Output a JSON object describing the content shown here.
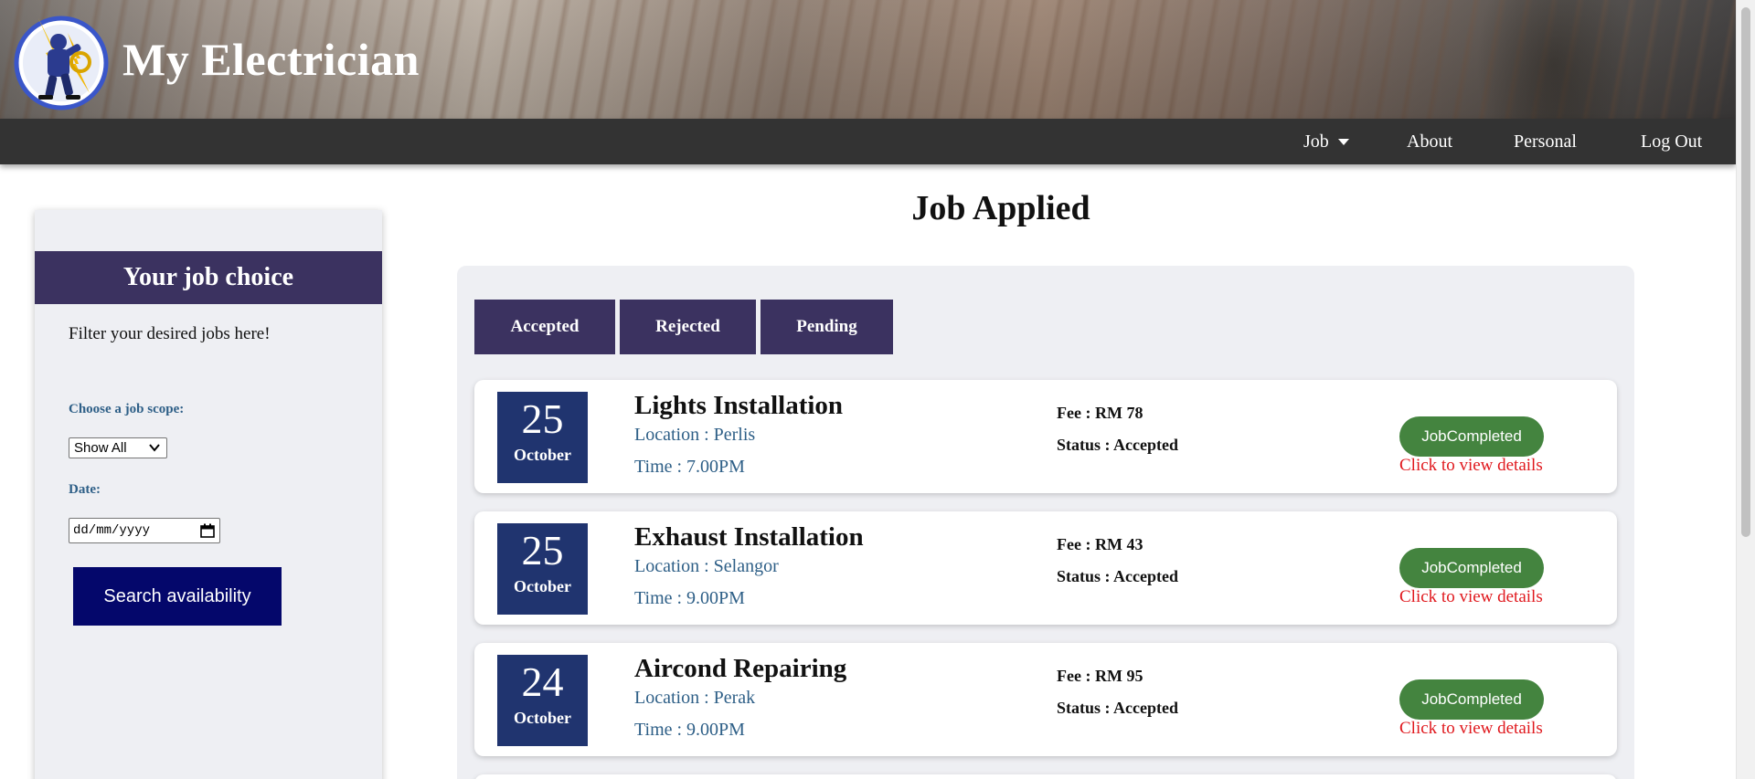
{
  "header": {
    "brand": "My Electrician",
    "logo_icon": "electrician-logo-icon"
  },
  "nav": {
    "job": "Job",
    "about": "About",
    "personal": "Personal",
    "logout": "Log Out"
  },
  "sidebar": {
    "heading": "Your job choice",
    "description": "Filter your desired jobs here!",
    "scope_label": "Choose a job scope:",
    "scope_selected": "Show All",
    "date_label": "Date:",
    "date_placeholder": "dd/mm/yyyy",
    "search_button": "Search availability"
  },
  "main": {
    "title": "Job Applied",
    "tabs": [
      {
        "label": "Accepted"
      },
      {
        "label": "Rejected"
      },
      {
        "label": "Pending"
      }
    ],
    "jobs": [
      {
        "day": "25",
        "month": "October",
        "title": "Lights Installation",
        "location": "Location : Perlis",
        "time": "Time : 7.00PM",
        "fee": "Fee : RM 78",
        "status": "Status : Accepted",
        "button": "JobCompleted",
        "link": "Click to view details"
      },
      {
        "day": "25",
        "month": "October",
        "title": "Exhaust Installation",
        "location": "Location : Selangor",
        "time": "Time : 9.00PM",
        "fee": "Fee : RM 43",
        "status": "Status : Accepted",
        "button": "JobCompleted",
        "link": "Click to view details"
      },
      {
        "day": "24",
        "month": "October",
        "title": "Aircond Repairing",
        "location": "Location : Perak",
        "time": "Time : 9.00PM",
        "fee": "Fee : RM 95",
        "status": "Status : Accepted",
        "button": "JobCompleted",
        "link": "Click to view details"
      }
    ]
  },
  "colors": {
    "nav_bg": "#333333",
    "accent_purple": "#3b3260",
    "date_blue": "#20346f",
    "search_button": "#04076b",
    "completed_green": "#44843f",
    "link_red": "#e0181d",
    "label_blue": "#2e5f87"
  }
}
